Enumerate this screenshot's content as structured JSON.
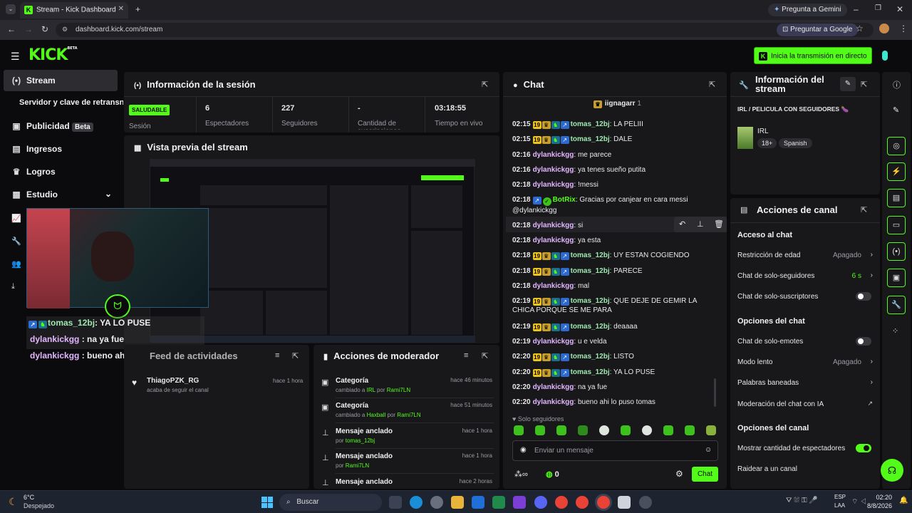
{
  "browser": {
    "tab_title": "Stream - Kick Dashboard",
    "gemini_button": "Pregunta a Gemini",
    "url": "dashboard.kick.com/stream",
    "google_button": "Preguntar a Google"
  },
  "header": {
    "logo": "KICK",
    "logo_badge": "BETA",
    "go_live_button": "Inicia la transmisión en directo"
  },
  "sidebar": {
    "items": [
      {
        "label": "Stream",
        "icon": "broadcast-icon"
      },
      {
        "label": "Servidor y clave de retransn",
        "icon": ""
      },
      {
        "label": "Publicidad",
        "badge": "Beta",
        "icon": "ad-icon"
      },
      {
        "label": "Ingresos",
        "icon": "chart-icon"
      },
      {
        "label": "Logros",
        "icon": "trophy-icon"
      },
      {
        "label": "Estudio",
        "icon": "studio-icon"
      }
    ]
  },
  "session": {
    "title": "Información de la sesión",
    "status": "SALUDABLE",
    "status_label": "Sesión",
    "stats": [
      {
        "value": "6",
        "label": "Espectadores"
      },
      {
        "value": "227",
        "label": "Seguidores"
      },
      {
        "value": "-",
        "label": "Cantidad de suscripciones"
      },
      {
        "value": "03:18:55",
        "label": "Tiempo en vivo"
      }
    ]
  },
  "preview": {
    "title": "Vista previa del stream"
  },
  "overlay_chat": [
    {
      "user": "tomas_12bj",
      "msg": ": YA LO PUSE"
    },
    {
      "user": "dylankickgg",
      "msg": " : na ya fue"
    },
    {
      "user": "dylankickgg",
      "msg": " : bueno ahi lo puso tomas"
    }
  ],
  "activity": {
    "title": "Feed de actividades",
    "items": [
      {
        "user": "ThiagoPZK_RG",
        "text": "acaba de seguir el canal",
        "time": "hace 1 hora"
      }
    ]
  },
  "mod_actions": {
    "title": "Acciones de moderador",
    "items": [
      {
        "title": "Categoría",
        "pre": "cambiado a ",
        "target": "IRL",
        "mid": " por ",
        "actor": "Rami7LN",
        "time": "hace 46 minutos"
      },
      {
        "title": "Categoría",
        "pre": "cambiado a ",
        "target": "Haxball",
        "mid": " por ",
        "actor": "Rami7LN",
        "time": "hace 51 minutos"
      },
      {
        "title": "Mensaje anclado",
        "pre": "por ",
        "target": "",
        "mid": "",
        "actor": "tomas_12bj",
        "time": "hace 1 hora"
      },
      {
        "title": "Mensaje anclado",
        "pre": "por ",
        "target": "",
        "mid": "",
        "actor": "Rami7LN",
        "time": "hace 1 hora"
      },
      {
        "title": "Mensaje anclado",
        "pre": "",
        "target": "",
        "mid": "",
        "actor": "",
        "time": "hace 2 horas"
      }
    ]
  },
  "chat": {
    "title": "Chat",
    "pinned_user": "iignagarr",
    "pinned_count": "1",
    "messages": [
      {
        "time": "02:15",
        "badges": true,
        "user": "tomas_12bj",
        "text": " LA PELIII"
      },
      {
        "time": "02:15",
        "badges": true,
        "user": "tomas_12bj",
        "text": " DALE"
      },
      {
        "time": "02:16",
        "badges": false,
        "user": "dylankickgg",
        "text": " me parece"
      },
      {
        "time": "02:16",
        "badges": false,
        "user": "dylankickgg",
        "text": " ya tenes sueño putita"
      },
      {
        "time": "02:18",
        "badges": false,
        "user": "dylankickgg",
        "text": " !messi"
      },
      {
        "time": "02:18",
        "badges": false,
        "user": "BotRix",
        "text": " Gracias por canjear en cara messi @dylankickgg"
      },
      {
        "time": "02:18",
        "badges": false,
        "user": "dylankickgg",
        "text": " si"
      },
      {
        "time": "02:18",
        "badges": false,
        "user": "dylankickgg",
        "text": " ya esta"
      },
      {
        "time": "02:18",
        "badges": true,
        "user": "tomas_12bj",
        "text": " UY ESTAN COGIENDO"
      },
      {
        "time": "02:18",
        "badges": true,
        "user": "tomas_12bj",
        "text": " PARECE"
      },
      {
        "time": "02:18",
        "badges": false,
        "user": "dylankickgg",
        "text": " mal"
      },
      {
        "time": "02:19",
        "badges": true,
        "user": "tomas_12bj",
        "text": " QUE DEJE DE GEMIR LA CHICA PORQUE SE ME PARA"
      },
      {
        "time": "02:19",
        "badges": true,
        "user": "tomas_12bj",
        "text": " deaaaa"
      },
      {
        "time": "02:19",
        "badges": false,
        "user": "dylankickgg",
        "text": " u e velda"
      },
      {
        "time": "02:20",
        "badges": true,
        "user": "tomas_12bj",
        "text": " LISTO"
      },
      {
        "time": "02:20",
        "badges": true,
        "user": "tomas_12bj",
        "text": " YA LO PUSE"
      },
      {
        "time": "02:20",
        "badges": false,
        "user": "dylankickgg",
        "text": " na ya fue"
      },
      {
        "time": "02:20",
        "badges": false,
        "user": "dylankickgg",
        "text": " bueno ahi lo puso tomas"
      }
    ],
    "followers_only": "Solo seguidores",
    "input_placeholder": "Enviar un mensaje",
    "points": "0",
    "send_button": "Chat"
  },
  "stream_info": {
    "title": "Información del stream",
    "stream_title": "IRL / PELICULA CON SEGUIDORES",
    "category": "IRL",
    "tags": [
      "18+",
      "Spanish"
    ]
  },
  "channel_actions": {
    "title": "Acciones de canal",
    "sections": [
      {
        "heading": "Acceso al chat"
      },
      {
        "heading": "Opciones del chat"
      },
      {
        "heading": "Opciones del canal"
      }
    ],
    "rows": [
      {
        "label": "Restricción de edad",
        "value": "Apagado"
      },
      {
        "label": "Chat de solo-seguidores",
        "value": "6 s"
      },
      {
        "label": "Chat de solo-suscriptores",
        "value": ""
      },
      {
        "label": "Chat de solo-emotes",
        "value": ""
      },
      {
        "label": "Modo lento",
        "value": "Apagado"
      },
      {
        "label": "Palabras baneadas",
        "value": ""
      },
      {
        "label": "Moderación del chat con IA",
        "value": ""
      },
      {
        "label": "Mostrar cantidad de espectadores",
        "value": ""
      },
      {
        "label": "Raidear a un canal",
        "value": ""
      }
    ]
  },
  "taskbar": {
    "temp": "6°C",
    "weather": "Despejado",
    "search": "Buscar",
    "lang": "ESP",
    "lang_sub": "LAA",
    "time": "02:20",
    "date": "8/8/2026"
  },
  "colors": {
    "accent": "#53fc18",
    "panel": "#18181b",
    "bg": "#0b0b0e"
  }
}
